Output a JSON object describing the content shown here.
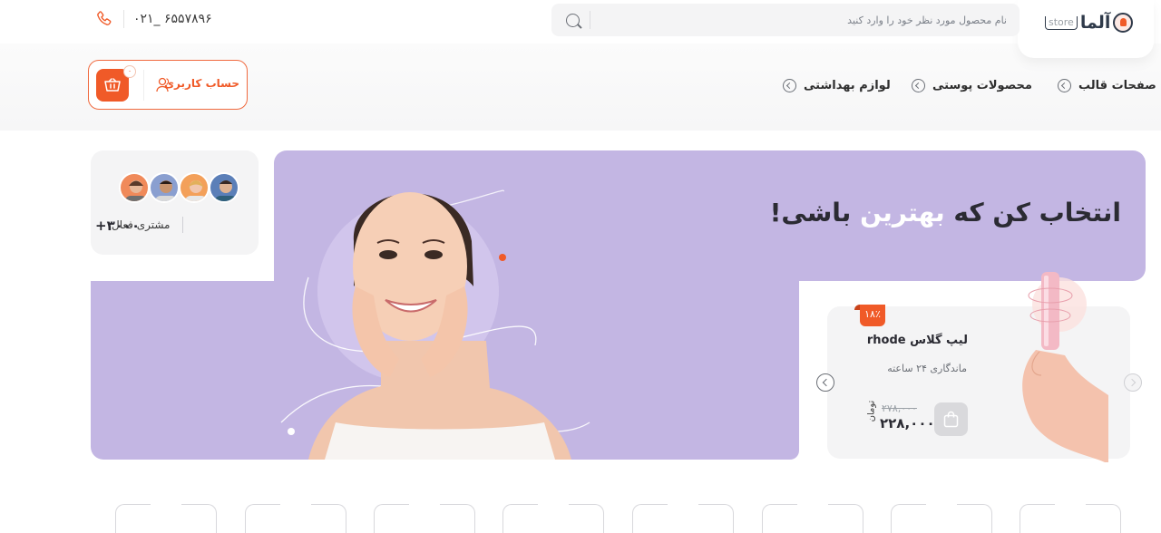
{
  "header": {
    "logo": {
      "name": "آلما",
      "suffix": "store"
    },
    "search": {
      "placeholder": "نام محصول مورد نظر خود را وارد کنید"
    },
    "phone": "۰۲۱_ ۶۵۵۷۸۹۶"
  },
  "nav": {
    "items": [
      {
        "label": "صفحات قالب"
      },
      {
        "label": "محصولات پوستی"
      },
      {
        "label": "لوازم بهداشتی"
      }
    ],
    "account_label": "حساب کاربری",
    "cart_count": "۰"
  },
  "hero": {
    "title_part1": "انتخاب کن که ",
    "title_highlight": "بهترین",
    "title_part2": " باشی!",
    "stats": {
      "count": "+۳۰۰۰",
      "label": "مشتری فعال"
    }
  },
  "product": {
    "discount": "۱۸٪",
    "title": "لیپ گلاس rhode",
    "subtitle": "ماندگاری ۲۴ ساعته",
    "old_price": "۲۷۸,۰۰۰",
    "price": "۲۲۸,۰۰۰",
    "currency": "تومان"
  },
  "colors": {
    "accent": "#f05a28",
    "hero_bg": "#c3b6e3",
    "card_bg": "#f4f4f5"
  },
  "icons": [
    "phone-icon",
    "search-icon",
    "chevron-left-icon",
    "cart-icon",
    "user-icon",
    "bag-icon"
  ]
}
